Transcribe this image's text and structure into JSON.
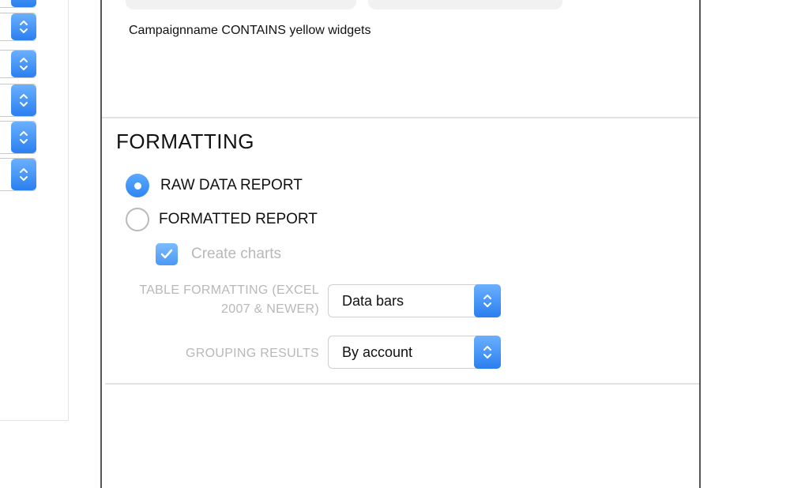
{
  "filter": {
    "condition_text": "Campaignname CONTAINS yellow widgets"
  },
  "formatting": {
    "title": "FORMATTING",
    "report_type_options": [
      {
        "label": "RAW DATA REPORT",
        "selected": true
      },
      {
        "label": "FORMATTED REPORT",
        "selected": false
      }
    ],
    "create_charts": {
      "label": "Create charts",
      "checked": true,
      "disabled": true
    },
    "table_formatting": {
      "label_line1": "TABLE FORMATTING (EXCEL",
      "label_line2": "2007 & NEWER)",
      "value": "Data bars"
    },
    "grouping_results": {
      "label": "GROUPING RESULTS",
      "value": "By account"
    }
  },
  "colors": {
    "accent": "#3b8ff5",
    "disabled_text": "#b8b8b8",
    "panel_border": "#555555"
  },
  "icons": {
    "select_stepper": "chevron-up-down-icon",
    "radio_selected": "radio-selected-icon",
    "checkbox": "checkmark-icon"
  }
}
